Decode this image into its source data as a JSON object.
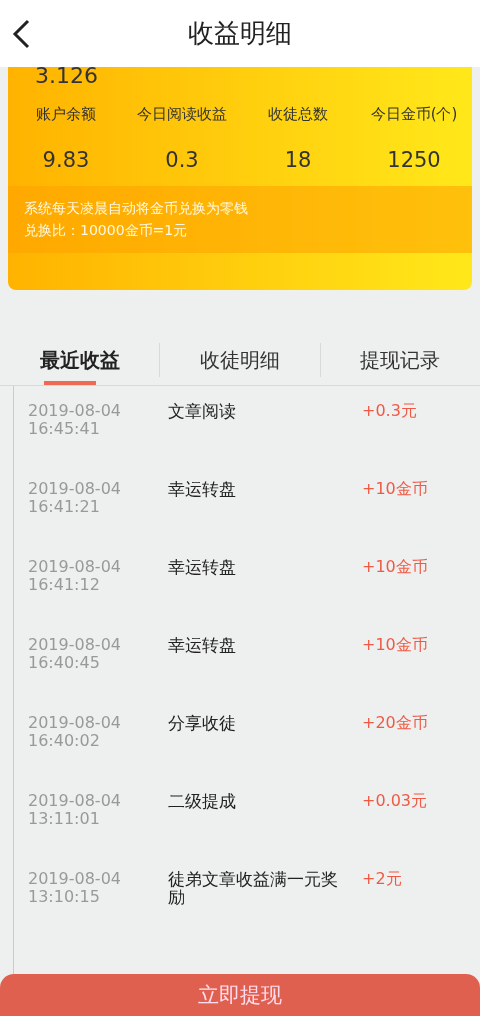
{
  "header": {
    "title": "收益明细"
  },
  "card": {
    "top_value": "3.126",
    "stats": [
      {
        "label": "账户余额",
        "value": "9.83"
      },
      {
        "label": "今日阅读收益",
        "value": "0.3"
      },
      {
        "label": "收徒总数",
        "value": "18"
      },
      {
        "label": "今日金币(个)",
        "value": "1250"
      }
    ],
    "notice": [
      "系统每天凌晨自动将金币兑换为零钱",
      "兑换比：10000金币=1元"
    ]
  },
  "tabs": [
    {
      "label": "最近收益",
      "selected": true
    },
    {
      "label": "收徒明细",
      "selected": false
    },
    {
      "label": "提现记录",
      "selected": false
    }
  ],
  "records": [
    {
      "date": "2019-08-04",
      "time": "16:45:41",
      "title": "文章阅读",
      "amount": "+0.3元"
    },
    {
      "date": "2019-08-04",
      "time": "16:41:21",
      "title": "幸运转盘",
      "amount": "+10金币"
    },
    {
      "date": "2019-08-04",
      "time": "16:41:12",
      "title": "幸运转盘",
      "amount": "+10金币"
    },
    {
      "date": "2019-08-04",
      "time": "16:40:45",
      "title": "幸运转盘",
      "amount": "+10金币"
    },
    {
      "date": "2019-08-04",
      "time": "16:40:02",
      "title": "分享收徒",
      "amount": "+20金币"
    },
    {
      "date": "2019-08-04",
      "time": "13:11:01",
      "title": "二级提成",
      "amount": "+0.03元"
    },
    {
      "date": "2019-08-04",
      "time": "13:10:15",
      "title": "徒弟文章收益满一元奖励",
      "amount": "+2元"
    }
  ],
  "button": "立即提现"
}
